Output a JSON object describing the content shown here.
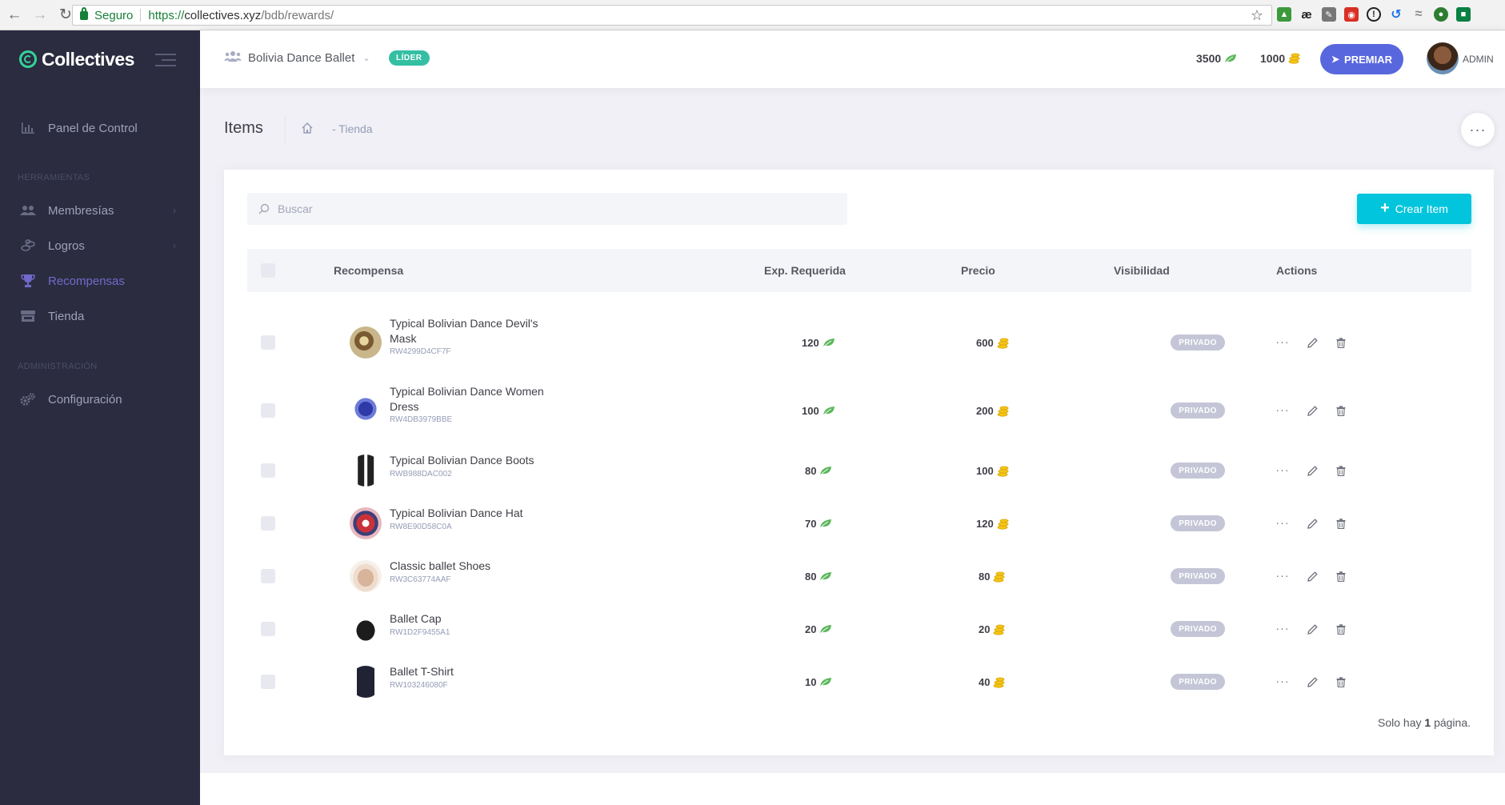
{
  "browser": {
    "secure_label": "Seguro",
    "url_proto": "https://",
    "url_host": "collectives.xyz",
    "url_path": "/bdb/rewards/"
  },
  "sidebar": {
    "brand": "Collectives",
    "items": [
      {
        "label": "Panel de Control",
        "icon": "bar-chart-icon"
      },
      {
        "label": "Membresías",
        "icon": "users-icon"
      },
      {
        "label": "Logros",
        "icon": "coins-icon"
      },
      {
        "label": "Recompensas",
        "icon": "trophy-icon"
      },
      {
        "label": "Tienda",
        "icon": "store-icon"
      },
      {
        "label": "Configuración",
        "icon": "gears-icon"
      }
    ],
    "section_tools": "HERRAMIENTAS",
    "section_admin": "ADMINISTRACIÓN"
  },
  "header": {
    "org_name": "Bolivia Dance Ballet",
    "role_badge": "LÍDER",
    "exp_balance": "3500",
    "coin_balance": "1000",
    "premiar_label": "PREMIAR",
    "user_label": "ADMIN"
  },
  "subheader": {
    "title": "Items",
    "breadcrumb": "- Tienda"
  },
  "search": {
    "placeholder": "Buscar"
  },
  "create_button": "Crear Item",
  "table": {
    "columns": {
      "reward": "Recompensa",
      "exp": "Exp. Requerida",
      "price": "Precio",
      "visibility": "Visibilidad",
      "actions": "Actions"
    },
    "rows": [
      {
        "name": "Typical Bolivian Dance Devil's Mask",
        "code": "RW4299D4CF7F",
        "exp": "120",
        "price": "600",
        "visibility": "PRIVADO"
      },
      {
        "name": "Typical Bolivian Dance Women Dress",
        "code": "RW4DB3979BBE",
        "exp": "100",
        "price": "200",
        "visibility": "PRIVADO"
      },
      {
        "name": "Typical Bolivian Dance Boots",
        "code": "RWB988DAC002",
        "exp": "80",
        "price": "100",
        "visibility": "PRIVADO"
      },
      {
        "name": "Typical Bolivian Dance Hat",
        "code": "RW8E90D58C0A",
        "exp": "70",
        "price": "120",
        "visibility": "PRIVADO"
      },
      {
        "name": "Classic ballet Shoes",
        "code": "RW3C63774AAF",
        "exp": "80",
        "price": "80",
        "visibility": "PRIVADO"
      },
      {
        "name": "Ballet Cap",
        "code": "RW1D2F9455A1",
        "exp": "20",
        "price": "20",
        "visibility": "PRIVADO"
      },
      {
        "name": "Ballet T-Shirt",
        "code": "RW103246080F",
        "exp": "10",
        "price": "40",
        "visibility": "PRIVADO"
      }
    ]
  },
  "pager": {
    "prefix": "Solo hay",
    "count": "1",
    "suffix": "página."
  },
  "colors": {
    "sidebar_bg": "#2b2c40",
    "accent_purple": "#716aca",
    "primary_blue": "#5867dd",
    "brand_green": "#33d399",
    "create_cyan": "#00c5dc",
    "badge_teal": "#34bfa3",
    "leaf_green": "#5cb85c",
    "coin_gold": "#f5c518"
  }
}
